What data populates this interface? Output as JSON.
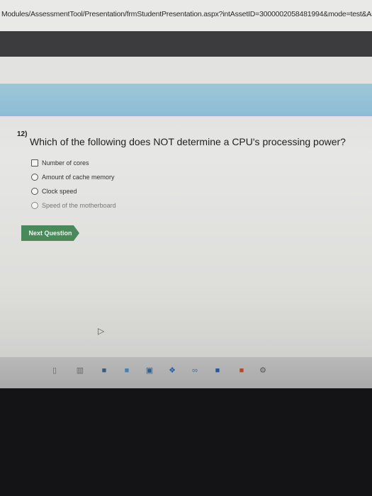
{
  "browser": {
    "url": "Modules/AssessmentTool/Presentation/frmStudentPresentation.aspx?intAssetID=300000205848199​4&mode=test&As"
  },
  "question": {
    "number": "12)",
    "text": "Which of the following does NOT determine a CPU's processing power?",
    "options": [
      "Number of cores",
      "Amount of cache memory",
      "Clock speed",
      "Speed of the motherboard"
    ]
  },
  "buttons": {
    "next_label": "Next Question"
  },
  "colors": {
    "banner": "#8dbcd2",
    "button": "#4a8a5a",
    "header_dark": "#3c3c3e"
  },
  "taskbar": {
    "icons": [
      "search-icon",
      "task-view-icon",
      "file-explorer-icon",
      "store-icon",
      "shopping-bag-icon",
      "dropbox-icon",
      "people-icon",
      "word-icon",
      "powerpoint-icon",
      "settings-icon"
    ]
  }
}
